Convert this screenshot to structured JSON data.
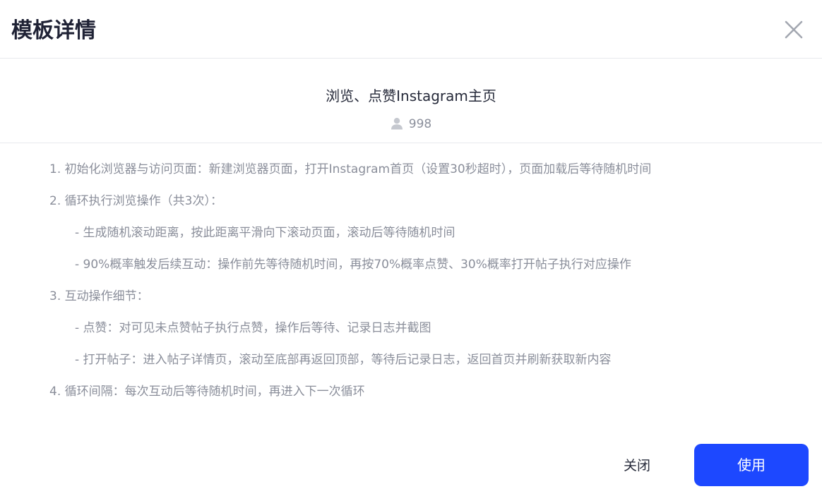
{
  "dialog": {
    "title": "模板详情",
    "close_icon": "close-icon"
  },
  "template": {
    "name": "浏览、点赞Instagram主页",
    "user_icon": "user-icon",
    "user_count": "998"
  },
  "steps": [
    "1. 初始化浏览器与访问页面：新建浏览器页面，打开Instagram首页（设置30秒超时），页面加载后等待随机时间",
    "2. 循环执行浏览操作（共3次）：",
    "- 生成随机滚动距离，按此距离平滑向下滚动页面，滚动后等待随机时间",
    "- 90%概率触发后续互动：操作前先等待随机时间，再按70%概率点赞、30%概率打开帖子执行对应操作",
    "3. 互动操作细节：",
    "- 点赞：对可见未点赞帖子执行点赞，操作后等待、记录日志并截图",
    "- 打开帖子：进入帖子详情页，滚动至底部再返回顶部，等待后记录日志，返回首页并刷新获取新内容",
    "4. 循环间隔：每次互动后等待随机时间，再进入下一次循环"
  ],
  "footer": {
    "close_label": "关闭",
    "use_label": "使用"
  },
  "colors": {
    "primary": "#1d48ff",
    "title_text": "#1f2235",
    "body_text": "#8a8e9a",
    "divider": "#e8eaed"
  }
}
